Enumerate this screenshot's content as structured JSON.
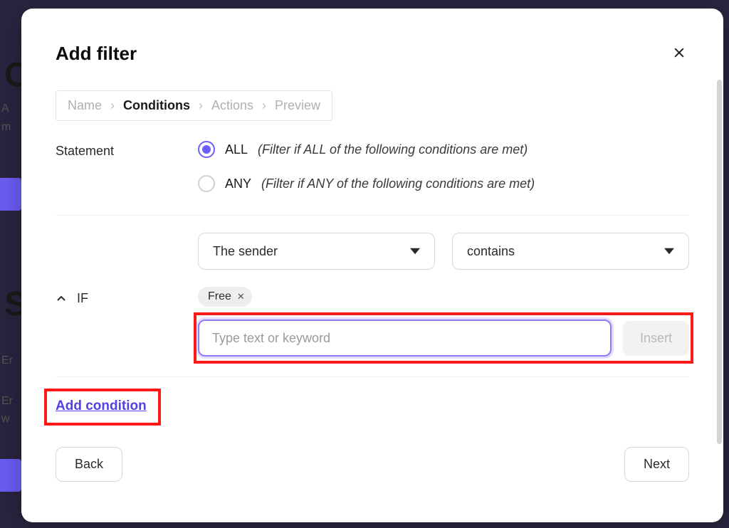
{
  "modal": {
    "title": "Add filter"
  },
  "breadcrumb": {
    "items": [
      {
        "label": "Name",
        "active": false
      },
      {
        "label": "Conditions",
        "active": true
      },
      {
        "label": "Actions",
        "active": false
      },
      {
        "label": "Preview",
        "active": false
      }
    ]
  },
  "statement": {
    "label": "Statement",
    "options": [
      {
        "key": "ALL",
        "hint": "(Filter if ALL of the following conditions are met)",
        "checked": true
      },
      {
        "key": "ANY",
        "hint": "(Filter if ANY of the following conditions are met)",
        "checked": false
      }
    ]
  },
  "condition": {
    "field_select": "The sender",
    "operator_select": "contains",
    "if_label": "IF",
    "chips": [
      {
        "text": "Free"
      }
    ],
    "input_placeholder": "Type text or keyword",
    "insert_label": "Insert"
  },
  "add_condition_label": "Add condition",
  "footer": {
    "back": "Back",
    "next": "Next"
  },
  "chevron_right": "›"
}
